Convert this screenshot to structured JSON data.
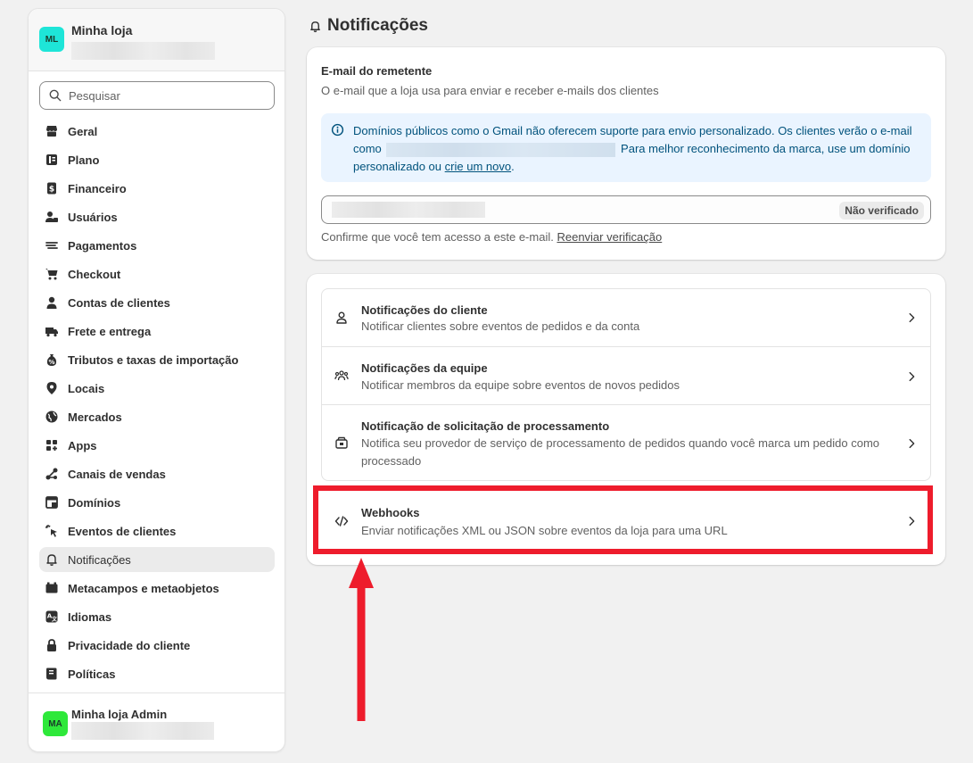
{
  "store": {
    "avatar": "ML",
    "name": "Minha loja"
  },
  "search": {
    "placeholder": "Pesquisar"
  },
  "nav": [
    {
      "label": "Geral",
      "icon": "store-icon"
    },
    {
      "label": "Plano",
      "icon": "plan-icon"
    },
    {
      "label": "Financeiro",
      "icon": "finance-icon"
    },
    {
      "label": "Usuários",
      "icon": "users-icon"
    },
    {
      "label": "Pagamentos",
      "icon": "payments-icon"
    },
    {
      "label": "Checkout",
      "icon": "cart-icon"
    },
    {
      "label": "Contas de clientes",
      "icon": "person-icon"
    },
    {
      "label": "Frete e entrega",
      "icon": "truck-icon"
    },
    {
      "label": "Tributos e taxas de importação",
      "icon": "tax-icon"
    },
    {
      "label": "Locais",
      "icon": "location-icon"
    },
    {
      "label": "Mercados",
      "icon": "globe-icon"
    },
    {
      "label": "Apps",
      "icon": "apps-icon"
    },
    {
      "label": "Canais de vendas",
      "icon": "channels-icon"
    },
    {
      "label": "Domínios",
      "icon": "domain-icon"
    },
    {
      "label": "Eventos de clientes",
      "icon": "events-icon"
    },
    {
      "label": "Notificações",
      "icon": "bell-icon",
      "active": true
    },
    {
      "label": "Metacampos e metaobjetos",
      "icon": "metafields-icon"
    },
    {
      "label": "Idiomas",
      "icon": "language-icon"
    },
    {
      "label": "Privacidade do cliente",
      "icon": "lock-icon"
    },
    {
      "label": "Políticas",
      "icon": "policy-icon"
    }
  ],
  "admin": {
    "avatar": "MA",
    "name": "Minha loja Admin"
  },
  "page": {
    "title": "Notificações"
  },
  "sender": {
    "title": "E-mail do remetente",
    "subtitle": "O e-mail que a loja usa para enviar e receber e-mails dos clientes",
    "banner_part1": "Domínios públicos como o Gmail não oferecem suporte para envio personalizado. Os clientes verão o e-mail como",
    "banner_part2": "Para melhor reconhecimento da marca, use um domínio personalizado ou",
    "banner_link": "crie um novo",
    "banner_end": ".",
    "status_badge": "Não verificado",
    "confirm_text": "Confirme que você tem acesso a este e-mail.",
    "resend_link": "Reenviar verificação"
  },
  "notifications": [
    {
      "title": "Notificações do cliente",
      "desc": "Notificar clientes sobre eventos de pedidos e da conta",
      "icon": "person-icon"
    },
    {
      "title": "Notificações da equipe",
      "desc": "Notificar membros da equipe sobre eventos de novos pedidos",
      "icon": "team-icon"
    },
    {
      "title": "Notificação de solicitação de processamento",
      "desc": "Notifica seu provedor de serviço de processamento de pedidos quando você marca um pedido como processado",
      "icon": "fulfillment-icon"
    }
  ],
  "webhooks": {
    "title": "Webhooks",
    "desc": "Enviar notificações XML ou JSON sobre eventos da loja para uma URL",
    "icon": "code-icon"
  },
  "colors": {
    "highlight": "#ee1c2c",
    "accent_banner": "#eaf4ff"
  }
}
